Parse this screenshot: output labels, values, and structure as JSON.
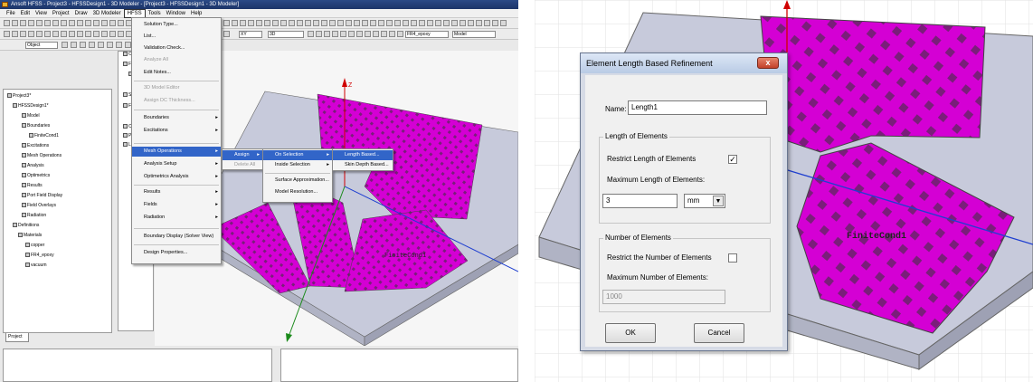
{
  "left_window": {
    "title": "Ansoft HFSS - Project3 - HFSSDesign1 - 3D Modeler - [Project3 - HFSSDesign1 - 3D Modeler]",
    "menu": [
      "File",
      "Edit",
      "View",
      "Project",
      "Draw",
      "3D Modeler",
      "HFSS",
      "Tools",
      "Window",
      "Help"
    ],
    "toolbar_combos": {
      "plane": "XY",
      "dim": "3D",
      "material": "FR4_epoxy",
      "model": "Model",
      "selection": "Object"
    },
    "tree": [
      "Project3*",
      "HFSSDesign1*",
      "Model",
      "Boundaries",
      "FiniteCond1",
      "Excitations",
      "Mesh Operations",
      "Analysis",
      "Optimetrics",
      "Results",
      "Port Field Display",
      "Field Overlays",
      "Radiation",
      "Definitions",
      "Materials",
      "copper",
      "FR4_epoxy",
      "vacuum"
    ],
    "tree_tab": "Project",
    "model_tree": [
      "Objects",
      "FR4_ep",
      "sub",
      "Sheets",
      "Finite C",
      "Coordinat",
      "Planes",
      "Lists"
    ],
    "hfss_menu": [
      {
        "label": "Solution Type...",
        "disabled": false,
        "sub": false
      },
      {
        "label": "List...",
        "disabled": false,
        "sub": false
      },
      {
        "label": "Validation Check...",
        "disabled": false,
        "sub": false
      },
      {
        "label": "Analyze All",
        "disabled": true,
        "sub": false
      },
      {
        "label": "Edit Notes...",
        "disabled": false,
        "sub": false
      },
      {
        "label": "3D Model Editor",
        "disabled": true,
        "sub": false
      },
      {
        "label": "Assign DC Thickness...",
        "disabled": true,
        "sub": false
      },
      {
        "label": "Boundaries",
        "disabled": false,
        "sub": true
      },
      {
        "label": "Excitations",
        "disabled": false,
        "sub": true
      },
      {
        "label": "Mesh Operations",
        "disabled": false,
        "sub": true
      },
      {
        "label": "Analysis Setup",
        "disabled": false,
        "sub": true
      },
      {
        "label": "Optimetrics Analysis",
        "disabled": false,
        "sub": true
      },
      {
        "label": "Results",
        "disabled": false,
        "sub": true
      },
      {
        "label": "Fields",
        "disabled": false,
        "sub": true
      },
      {
        "label": "Radiation",
        "disabled": false,
        "sub": true
      },
      {
        "label": "Boundary Display (Solver View)",
        "disabled": false,
        "sub": false
      },
      {
        "label": "Design Properties...",
        "disabled": false,
        "sub": false
      }
    ],
    "mesh_submenu": [
      {
        "label": "Assign",
        "disabled": false,
        "sub": true
      },
      {
        "label": "Delete All",
        "disabled": true,
        "sub": false
      }
    ],
    "assign_submenu": [
      {
        "label": "On Selection",
        "sub": true
      },
      {
        "label": "Inside Selection",
        "sub": true
      },
      {
        "label": "Surface Approximation...",
        "sub": false
      },
      {
        "label": "Model Resolution...",
        "sub": false
      }
    ],
    "on_selection_submenu": [
      "Length Based...",
      "Skin Depth Based..."
    ],
    "viewport_label": "FiniteCond1",
    "axis_z": "Z"
  },
  "dialog": {
    "title": "Element Length Based Refinement",
    "name_label": "Name:",
    "name_value": "Length1",
    "group1_title": "Length of Elements",
    "restrict_length_label": "Restrict Length of Elements",
    "restrict_length_checked": "✓",
    "max_length_label": "Maximum Length of Elements:",
    "max_length_value": "3",
    "unit": "mm",
    "group2_title": "Number of Elements",
    "restrict_number_label": "Restrict the Number of Elements",
    "max_number_label": "Maximum Number of  Elements:",
    "max_number_value": "1000",
    "ok": "OK",
    "cancel": "Cancel",
    "close": "x"
  },
  "right_viewport_label": "FiniteCond1",
  "colors": {
    "metal": "#d400d4",
    "metal_pattern": "#7a1e7a",
    "substrate": "#c7cadb",
    "axis_z": "#d00000",
    "axis_x": "#1f3fd0",
    "axis_y": "#1a8a1a",
    "selection_hl": "#3265c8"
  }
}
